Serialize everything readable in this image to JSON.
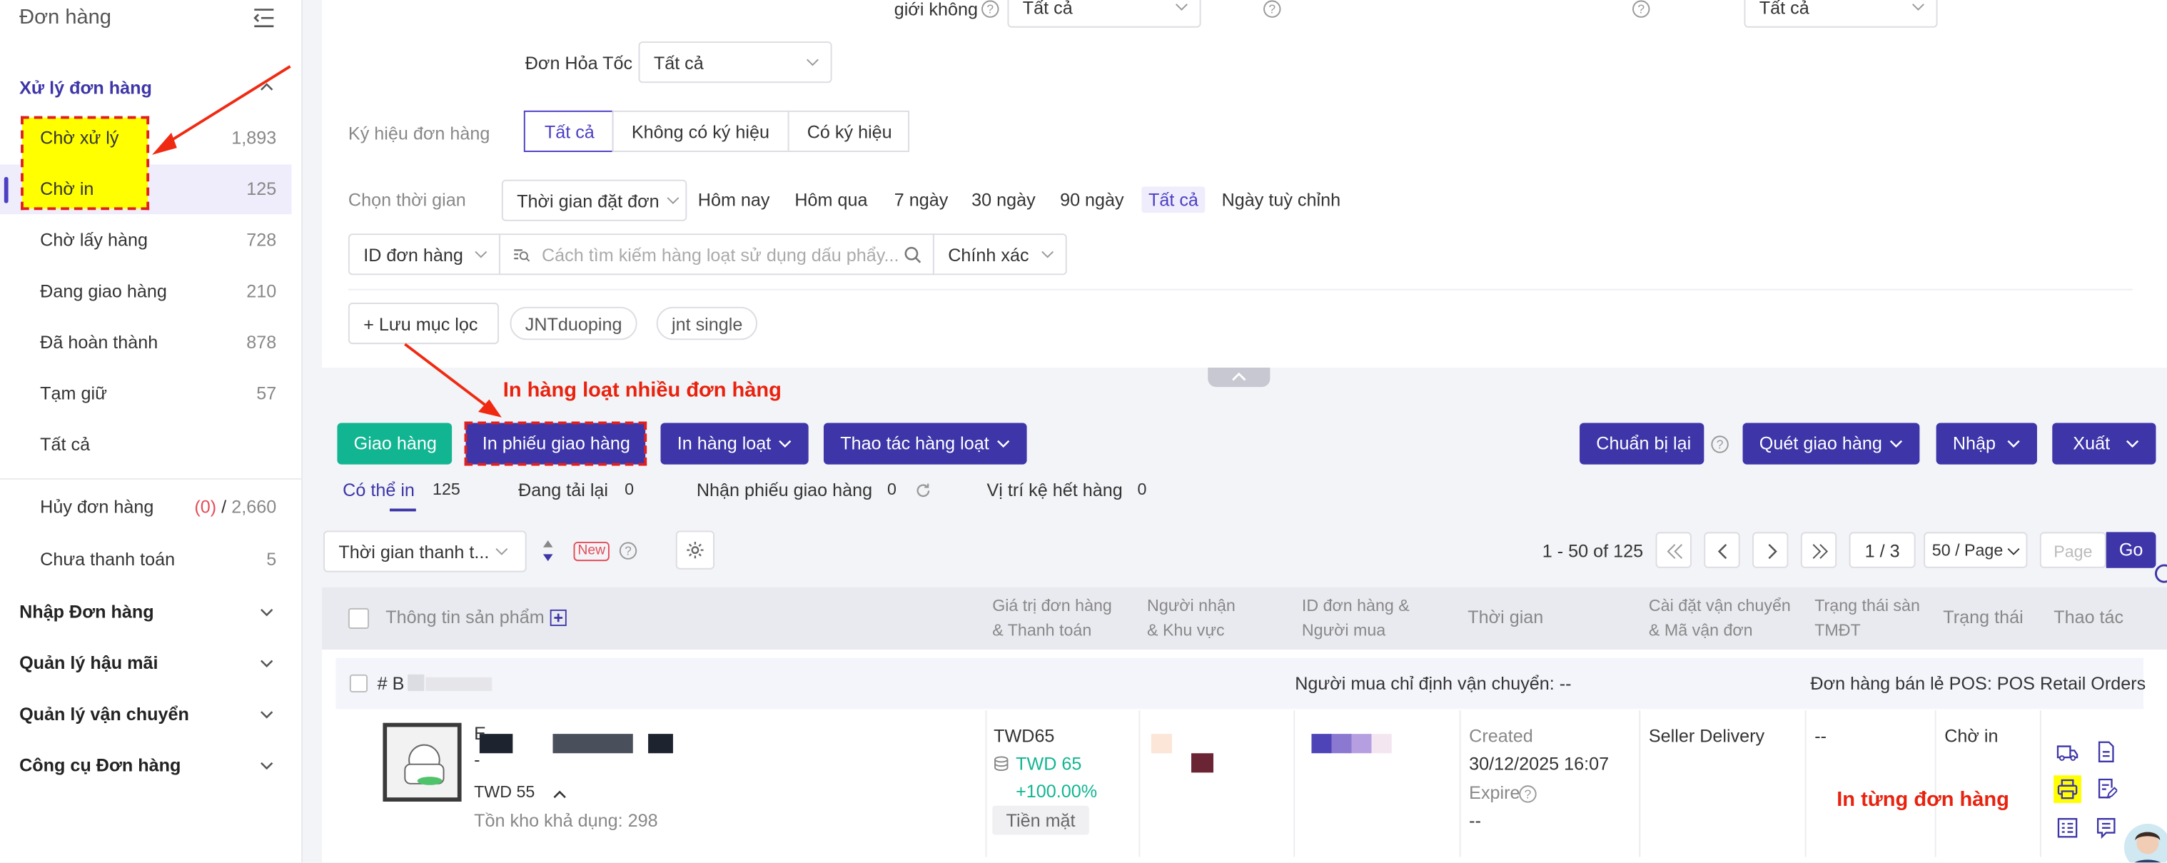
{
  "sidebar": {
    "title": "Đơn hàng",
    "group_orders": "Xử lý đơn hàng",
    "items": [
      {
        "label": "Chờ xử lý",
        "count": "1,893"
      },
      {
        "label": "Chờ in",
        "count": "125"
      },
      {
        "label": "Chờ lấy hàng",
        "count": "728"
      },
      {
        "label": "Đang giao hàng",
        "count": "210"
      },
      {
        "label": "Đã hoàn thành",
        "count": "878"
      },
      {
        "label": "Tạm giữ",
        "count": "57"
      },
      {
        "label": "Tất cả",
        "count": ""
      }
    ],
    "cancel": {
      "label": "Hủy đơn hàng",
      "count_red": "(0)",
      "sep": "/",
      "count": "2,660"
    },
    "unpaid": {
      "label": "Chưa thanh toán",
      "count": "5"
    },
    "groups": [
      "Nhập Đơn hàng",
      "Quản lý hậu mãi",
      "Quản lý vận chuyển",
      "Công cụ Đơn hàng"
    ]
  },
  "filters": {
    "top_label": "giới không",
    "top_select1": "Tất cả",
    "top_select2": "Tất cả",
    "express_label": "Đơn Hỏa Tốc",
    "express_value": "Tất cả",
    "symbol_label": "Ký hiệu đơn hàng",
    "symbol_options": [
      "Tất cả",
      "Không có ký hiệu",
      "Có ký hiệu"
    ],
    "time_label": "Chọn thời gian",
    "time_type": "Thời gian đặt đơn",
    "time_options": [
      "Hôm nay",
      "Hôm qua",
      "7 ngày",
      "30 ngày",
      "90 ngày",
      "Tất cả",
      "Ngày tuỳ chỉnh"
    ],
    "id_select": "ID đơn hàng",
    "search_placeholder": "Cách tìm kiếm hàng loạt sử dụng dấu phẩy...",
    "match_select": "Chính xác",
    "save_filter": "+ Lưu mục lọc",
    "saved_tags": [
      "JNTduoping",
      "jnt single"
    ]
  },
  "annotations": {
    "bulk": "In hàng loạt nhiều đơn hàng",
    "single": "In từng đơn hàng"
  },
  "toolbar": {
    "ship": "Giao hàng",
    "print_slip": "In phiếu giao hàng",
    "bulk_print": "In hàng loạt",
    "bulk_action": "Thao tác hàng loạt",
    "prepare_again": "Chuẩn bị lại",
    "scan_ship": "Quét giao hàng",
    "import": "Nhập",
    "export": "Xuất"
  },
  "tabs": [
    {
      "label": "Có thể in",
      "count": "125"
    },
    {
      "label": "Đang tải lại",
      "count": "0"
    },
    {
      "label": "Nhận phiếu giao hàng",
      "count": "0"
    },
    {
      "label": "Vị trí kệ hết hàng",
      "count": "0"
    }
  ],
  "sort": {
    "label": "Thời gian thanh t...",
    "new_badge": "New"
  },
  "pager": {
    "range": "1 - 50 of 125",
    "page": "1 / 3",
    "per_page": "50 / Page",
    "page_placeholder": "Page",
    "go": "Go"
  },
  "table": {
    "headers": {
      "product": "Thông tin sản phẩm",
      "value1": "Giá trị đơn hàng",
      "value2": "& Thanh toán",
      "recv1": "Người nhận",
      "recv2": "& Khu vực",
      "id1": "ID đơn hàng &",
      "id2": "Người mua",
      "time": "Thời gian",
      "ship1": "Cài đặt vận chuyển",
      "ship2": "& Mã vận đơn",
      "tmdt1": "Trạng thái sàn",
      "tmdt2": "TMĐT",
      "status": "Trạng thái",
      "action": "Thao tác"
    },
    "order": {
      "hash": "# B",
      "buyer_shipping": "Người mua chỉ định vận chuyển: --",
      "pos": "Đơn hàng bán lẻ POS: POS Retail Orders",
      "product_dash": "-",
      "product_price": "TWD 55",
      "stock": "Tồn kho khả dụng: 298",
      "value": "TWD65",
      "paid": "TWD 65",
      "percent": "+100.00%",
      "pay_method": "Tiền mặt",
      "created_label": "Created",
      "created": "30/12/2025 16:07",
      "expire_label": "Expire",
      "expire": "--",
      "carrier": "Seller Delivery",
      "tmdt": "--",
      "status": "Chờ in"
    }
  },
  "colors": {
    "primary": "#3d35a8",
    "green": "#12b592",
    "annotation": "#e8220e",
    "highlight": "#ffff00"
  }
}
